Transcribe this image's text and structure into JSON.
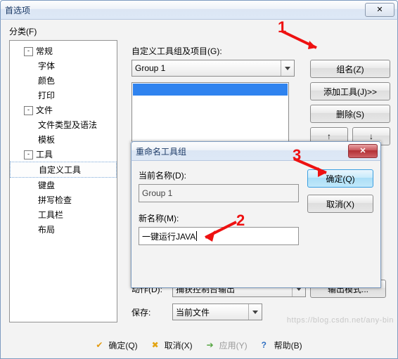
{
  "main": {
    "title": "首选项",
    "category_label": "分类(F)",
    "tree": {
      "n0": "常规",
      "n0_1": "字体",
      "n0_2": "颜色",
      "n0_3": "打印",
      "n1": "文件",
      "n1_1": "文件类型及语法",
      "n1_2": "模板",
      "n2": "工具",
      "n2_1": "自定义工具",
      "n2_2": "键盘",
      "n2_3": "拼写检查",
      "n2_4": "工具栏",
      "n2_5": "布局"
    },
    "groups_label": "自定义工具组及项目(G):",
    "group_select": "Group 1",
    "btn_group_name": "组名(Z)",
    "btn_add_tool": "添加工具(J)>>",
    "btn_delete": "删除(S)",
    "btn_up": "↑",
    "btn_down": "↓",
    "action_label": "动作(D):",
    "action_value": "捕获控制台输出",
    "btn_output_mode": "输出模式...",
    "save_label": "保存:",
    "save_value": "当前文件",
    "ok": "确定(Q)",
    "cancel": "取消(X)",
    "apply": "应用(Y)",
    "help": "帮助(B)"
  },
  "rename": {
    "title": "重命名工具组",
    "current_label": "当前名称(D):",
    "current_value": "Group 1",
    "new_label": "新名称(M):",
    "new_value": "一键运行JAVA",
    "ok": "确定(Q)",
    "cancel": "取消(X)"
  },
  "anno": {
    "n1": "1",
    "n2": "2",
    "n3": "3"
  },
  "watermark": "https://blog.csdn.net/any-bin"
}
